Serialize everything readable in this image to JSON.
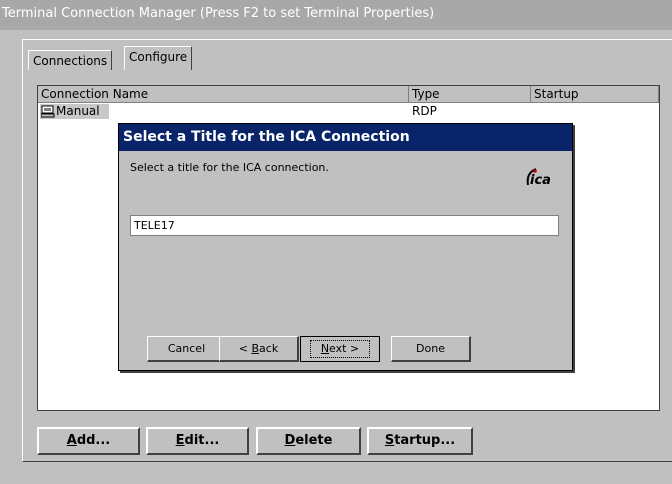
{
  "window": {
    "title": "Terminal Connection Manager (Press F2 to set Terminal Properties)"
  },
  "tabs": [
    {
      "label": "Connections"
    },
    {
      "label": "Configure"
    }
  ],
  "list": {
    "columns": [
      "Connection Name",
      "Type",
      "Startup"
    ],
    "rows": [
      {
        "name": "Manual",
        "type": "RDP",
        "startup": ""
      }
    ]
  },
  "buttons": {
    "add": {
      "mnemonic": "A",
      "rest": "dd..."
    },
    "edit": {
      "mnemonic": "E",
      "rest": "dit..."
    },
    "delete": {
      "mnemonic": "D",
      "rest": "elete"
    },
    "startup": {
      "mnemonic": "S",
      "rest": "tartup..."
    }
  },
  "dialog": {
    "title": "Select a Title for the ICA Connection",
    "prompt": "Select a title for the ICA connection.",
    "input_value": "TELE17",
    "logo_text": "ica",
    "cancel": "Cancel",
    "back_prefix": "< ",
    "back_mnemonic": "B",
    "back_rest": "ack",
    "next_mnemonic": "N",
    "next_rest": "ext >",
    "done": "Done"
  },
  "colors": {
    "dialog_title_bg": "#0a246a",
    "window_bg": "#c0c0c0",
    "titlebar_bg": "#a8a8a8"
  }
}
